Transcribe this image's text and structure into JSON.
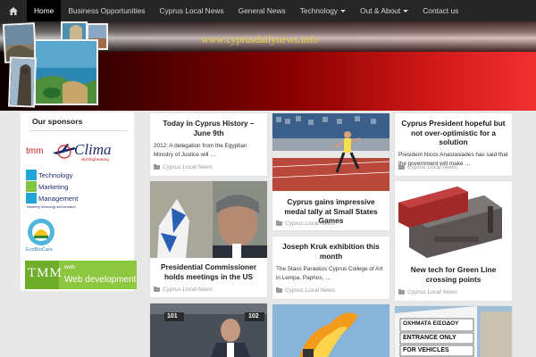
{
  "nav": {
    "items": [
      {
        "label": "Home",
        "active": true
      },
      {
        "label": "Business Opportunities"
      },
      {
        "label": "Cyprus Local News"
      },
      {
        "label": "General News"
      },
      {
        "label": "Technology",
        "dropdown": true
      },
      {
        "label": "Out & About",
        "dropdown": true
      },
      {
        "label": "Contact us"
      }
    ]
  },
  "banner": {
    "url": "www.cyprusdailynews.info"
  },
  "sidebar": {
    "title": "Our sponsors",
    "sponsors": [
      {
        "name_a": "tmm",
        "name_b": "Clima",
        "tagline": "skirtingheating"
      },
      {
        "line1": "Technology",
        "line2": "Marketing",
        "line3": "Management",
        "tagline": "Delivering Technology and Innovation"
      },
      {
        "name": "EcoBioCare"
      },
      {
        "name": "TMM",
        "line1": "web",
        "line2": "Web development"
      }
    ]
  },
  "articles": [
    {
      "title": "Today in Cyprus History – June 9th",
      "excerpt": "2012: A delegation from the Egyptian Ministry of Justice will …",
      "category": "Cyprus Local News"
    },
    {
      "title": "Cyprus gains impressive medal tally at Small States Games",
      "category": "Cyprus Local News"
    },
    {
      "title": "Cyprus President hopeful but not over-optimistic for a solution",
      "excerpt": "President Nicos Anastasiades has said that the government will make …",
      "category": "Cyprus Local News"
    },
    {
      "title": "Presidential Commissioner holds meetings in the US",
      "category": "Cyprus Local News"
    },
    {
      "title": "Joseph Kruk exhibition this month",
      "excerpt": "The Stass Paraskos Cyprus College of Art in Lempa, Paphos, …",
      "category": "Cyprus Local News"
    },
    {
      "title": "New tech for Green Line crossing points",
      "category": "Cyprus Local News"
    }
  ],
  "photo_overlays": {
    "seat_left": "101",
    "seat_right": "102",
    "sign_line1": "ΟΧΗΜΑΤΑ ΕΙΣΟΔΟΥ",
    "sign_line2": "ENTRANCE ONLY",
    "sign_line3": "FOR VEHICLES"
  }
}
